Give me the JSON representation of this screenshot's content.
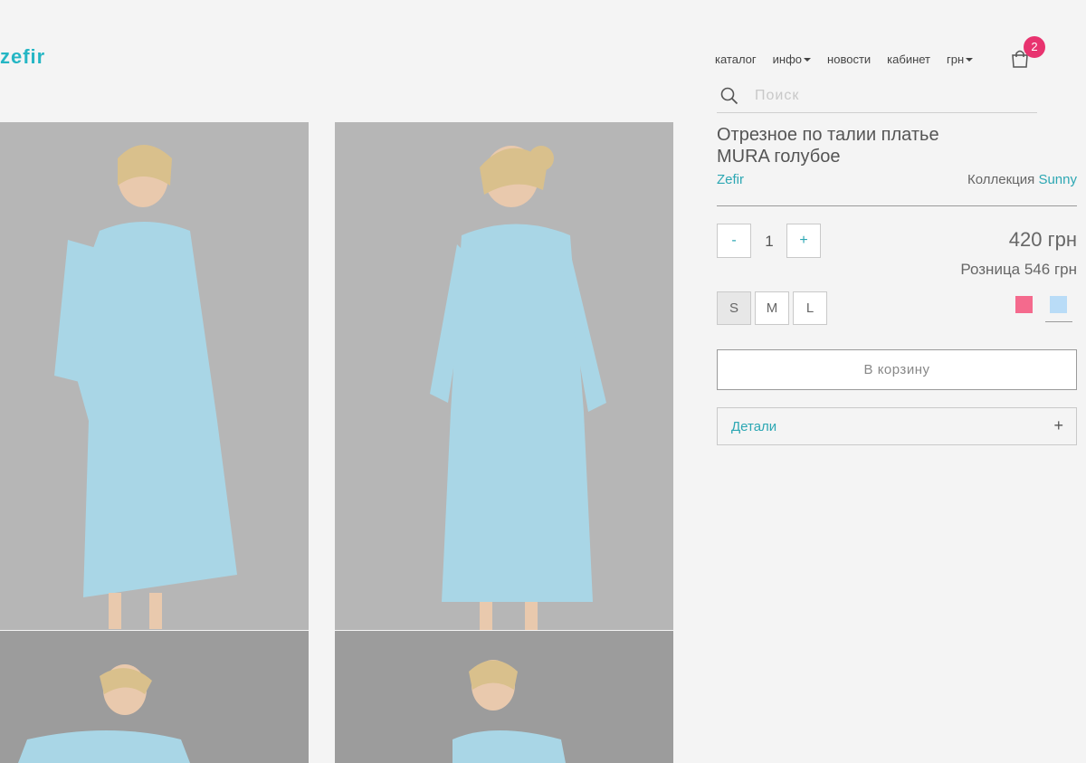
{
  "logo": {
    "text": "zefir"
  },
  "nav": {
    "items": [
      {
        "label": "каталог",
        "dropdown": false
      },
      {
        "label": "инфо",
        "dropdown": true
      },
      {
        "label": "новости",
        "dropdown": false
      },
      {
        "label": "кабинет",
        "dropdown": false
      },
      {
        "label": "грн",
        "dropdown": true
      }
    ],
    "cart_count": "2"
  },
  "search": {
    "placeholder": "Поиск"
  },
  "product": {
    "title": "Отрезное по талии платье MURA голубое",
    "brand": "Zefir",
    "collection_label": "Коллекция",
    "collection_name": "Sunny",
    "quantity": {
      "minus": "-",
      "value": "1",
      "plus": "+"
    },
    "price": "420 грн",
    "retail": "Розница 546 грн",
    "sizes": [
      {
        "label": "S",
        "selected": true
      },
      {
        "label": "M",
        "selected": false
      },
      {
        "label": "L",
        "selected": false
      }
    ],
    "colors": [
      {
        "hex": "#f46a8d",
        "selected": false
      },
      {
        "hex": "#b9dcf7",
        "selected": true
      }
    ],
    "add_to_cart": "В корзину",
    "details_label": "Детали",
    "details_toggle": "+"
  },
  "gallery": {
    "images": [
      "front-view-photo",
      "back-view-photo",
      "side-view-photo",
      "portrait-photo"
    ]
  }
}
